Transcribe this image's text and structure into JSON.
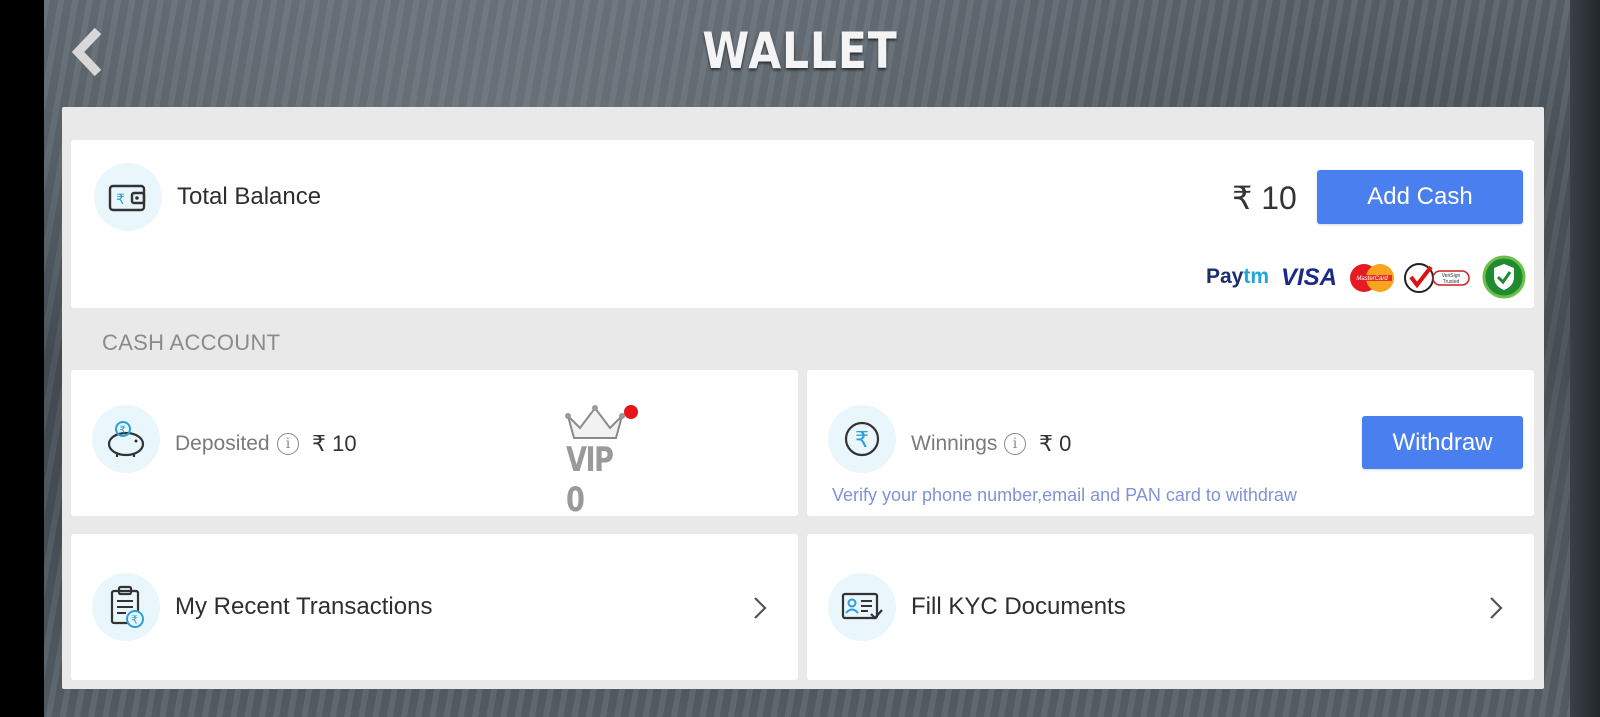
{
  "header": {
    "title": "WALLET",
    "back_icon": "chevron-left-icon"
  },
  "total_balance": {
    "label": "Total Balance",
    "amount": "₹ 10",
    "add_cash_label": "Add Cash",
    "icon": "wallet-icon",
    "payment_logos": [
      "Paytm",
      "VISA",
      "MasterCard",
      "VeriSign Trusted",
      "verified-badge"
    ]
  },
  "cash_account": {
    "section_label": "CASH ACCOUNT",
    "deposited": {
      "label": "Deposited",
      "amount": "₹ 10",
      "icon": "piggy-bank-icon"
    },
    "vip": {
      "label": "VIP 0",
      "icon": "crown-icon"
    },
    "winnings": {
      "label": "Winnings",
      "amount": "₹ 0",
      "icon": "rupee-icon",
      "withdraw_label": "Withdraw",
      "verify_note": "Verify your phone number,email and PAN card to withdraw"
    }
  },
  "links": {
    "transactions": {
      "label": "My Recent Transactions",
      "icon": "clipboard-rupee-icon"
    },
    "kyc": {
      "label": "Fill KYC Documents",
      "icon": "id-card-icon"
    }
  },
  "colors": {
    "accent": "#4a7ff0",
    "icon_bg": "#e9f6fc",
    "panel_bg": "#e9e9e9",
    "note": "#7f93d6"
  }
}
